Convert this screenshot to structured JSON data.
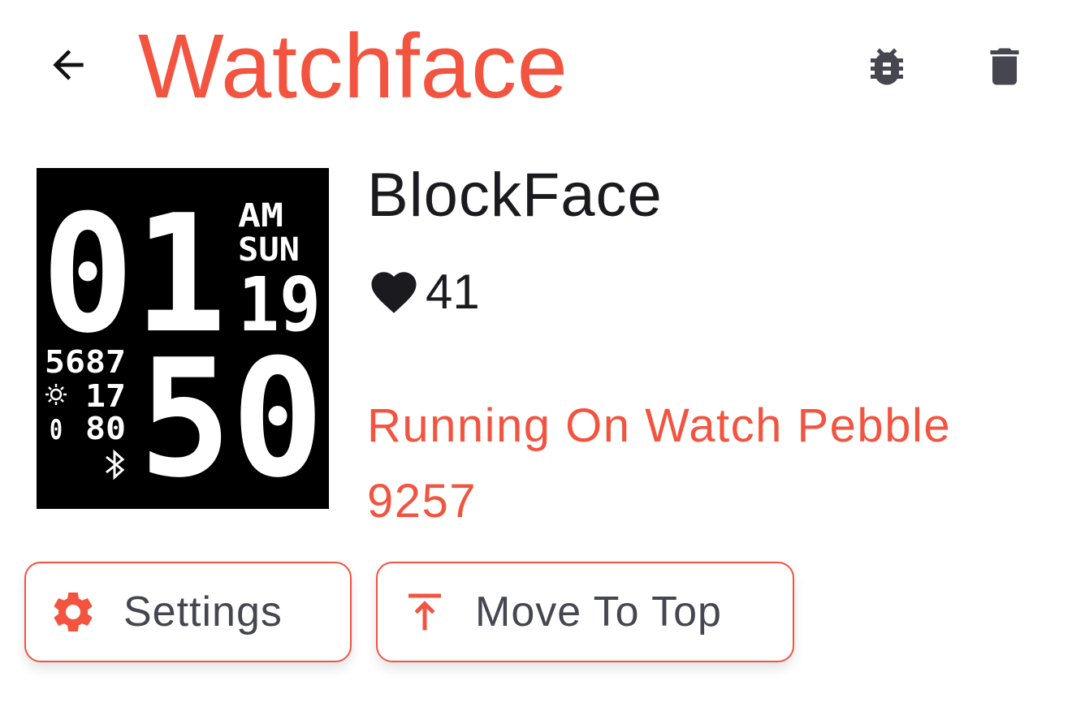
{
  "colors": {
    "accent": "#f25440",
    "icon_dark": "#45464f",
    "text_dark": "#1b1b1f",
    "background": "#ffffff"
  },
  "header": {
    "back_icon": "arrow-back-icon",
    "title": "Watchface",
    "actions": [
      {
        "name": "debug",
        "icon": "bug-icon"
      },
      {
        "name": "delete",
        "icon": "trash-icon"
      }
    ]
  },
  "app": {
    "name": "BlockFace",
    "hearts_icon": "heart-icon",
    "hearts": "41",
    "status": "Running On Watch Pebble 9257"
  },
  "preview": {
    "hour": "01",
    "minute": "50",
    "ampm": "AM",
    "weekday": "SUN",
    "day": "19",
    "steps": "5687",
    "temperature": "17",
    "battery": "80",
    "battery_prefix": "0",
    "weather_icon": "sun-icon",
    "bluetooth_icon": "bluetooth-icon"
  },
  "actions": {
    "settings": {
      "label": "Settings",
      "icon": "gear-icon"
    },
    "move_to_top": {
      "label": "Move To Top",
      "icon": "move-to-top-icon"
    }
  }
}
